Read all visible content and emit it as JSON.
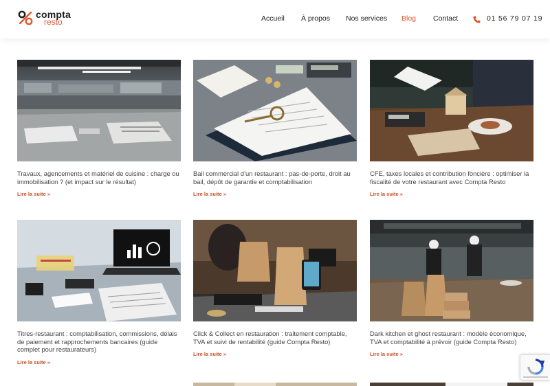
{
  "brand": {
    "word1": "compta",
    "word2": "resto",
    "accent": "#e2562d"
  },
  "nav": [
    {
      "label": "Accueil",
      "active": false
    },
    {
      "label": "À propos",
      "active": false
    },
    {
      "label": "Nos services",
      "active": false
    },
    {
      "label": "Blog",
      "active": true
    },
    {
      "label": "Contact",
      "active": false
    }
  ],
  "phone": {
    "icon": "phone-icon",
    "number": "01 56 79 07 19"
  },
  "read_more_label": "Lire la suite »",
  "posts": [
    {
      "title": "Travaux, agencements et matériel de cuisine : charge ou immobilisation ? (et impact sur le résultat)",
      "more": "Lire la suite »"
    },
    {
      "title": "Bail commercial d’un restaurant : pas-de-porte, droit au bail, dépôt de garantie et comptabilisation",
      "more": "Lire la suite »"
    },
    {
      "title": "CFE, taxes locales et contribution foncière : optimiser la fiscalité de votre restaurant avec Compta Resto",
      "more": "Lire la suite »"
    },
    {
      "title": "Titres-restaurant : comptabilisation, commissions, délais de paiement et rapprochements bancaires (guide complet pour restaurateurs)",
      "more": "Lire la suite »"
    },
    {
      "title": "Click & Collect en restauration : traitement comptable, TVA et suivi de rentabilité (guide Compta Resto)",
      "more": "Lire la suite »"
    },
    {
      "title": "Dark kitchen et ghost restaurant : modèle économique, TVA et comptabilité à prévoir (guide Compta Resto)",
      "more": "Lire la suite »"
    }
  ],
  "recaptcha": {
    "icon": "recaptcha-icon"
  }
}
